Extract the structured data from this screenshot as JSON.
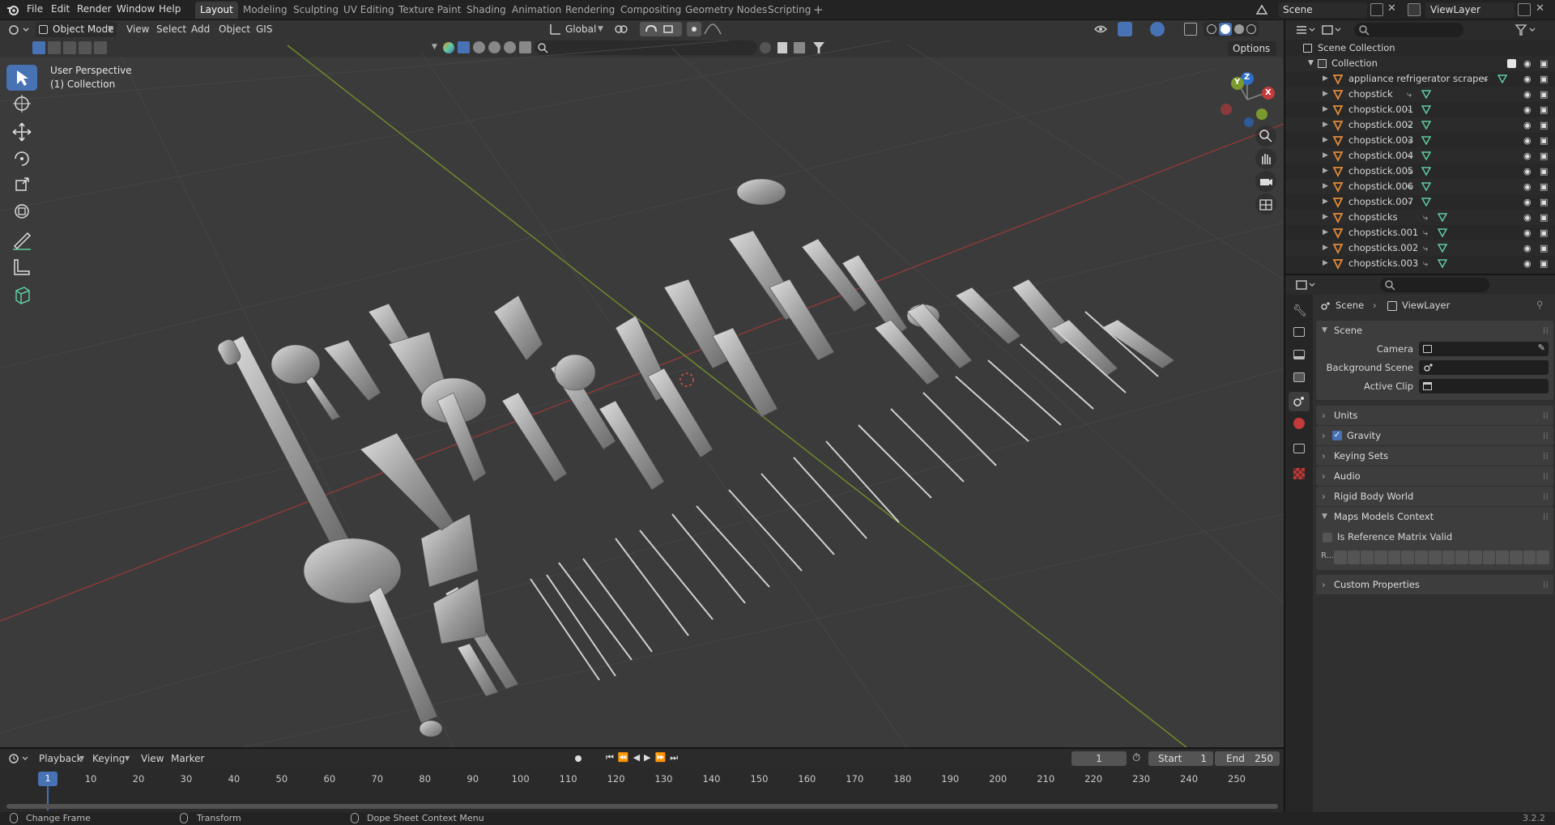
{
  "app": {
    "version": "3.2.2"
  },
  "menubar": {
    "items": [
      "File",
      "Edit",
      "Render",
      "Window",
      "Help"
    ]
  },
  "workspaces": {
    "tabs": [
      "Layout",
      "Modeling",
      "Sculpting",
      "UV Editing",
      "Texture Paint",
      "Shading",
      "Animation",
      "Rendering",
      "Compositing",
      "Geometry Nodes",
      "Scripting"
    ],
    "active": "Layout",
    "add": "+"
  },
  "topright": {
    "scene": "Scene",
    "view_layer": "ViewLayer"
  },
  "viewport_header": {
    "mode": "Object Mode",
    "menus": [
      "View",
      "Select",
      "Add",
      "Object",
      "GIS"
    ],
    "orientation": "Global",
    "options": "Options"
  },
  "viewport": {
    "perspective": "User Perspective",
    "collection": "(1) Collection",
    "gizmo": {
      "x": "X",
      "y": "Y",
      "z": "Z"
    }
  },
  "tools": [
    {
      "name": "select-box-tool",
      "active": true
    },
    {
      "name": "cursor-tool",
      "active": false
    },
    {
      "name": "move-tool",
      "active": false
    },
    {
      "name": "rotate-tool",
      "active": false
    },
    {
      "name": "scale-tool",
      "active": false
    },
    {
      "name": "transform-tool",
      "active": false
    },
    {
      "name": "annotate-tool",
      "active": false
    },
    {
      "name": "measure-tool",
      "active": false
    },
    {
      "name": "add-cube-tool",
      "active": false
    }
  ],
  "outliner": {
    "root": "Scene Collection",
    "collection": "Collection",
    "items": [
      "appliance refrigerator scraper",
      "chopstick",
      "chopstick.001",
      "chopstick.002",
      "chopstick.003",
      "chopstick.004",
      "chopstick.005",
      "chopstick.006",
      "chopstick.007",
      "chopsticks",
      "chopsticks.001",
      "chopsticks.002",
      "chopsticks.003"
    ]
  },
  "properties": {
    "breadcrumb": [
      "Scene",
      "ViewLayer"
    ],
    "panel_title": "Scene",
    "fields": [
      {
        "label": "Camera",
        "value": ""
      },
      {
        "label": "Background Scene",
        "value": ""
      },
      {
        "label": "Active Clip",
        "value": ""
      }
    ],
    "sections": [
      "Units",
      "Gravity",
      "Keying Sets",
      "Audio",
      "Rigid Body World",
      "Maps Models Context"
    ],
    "gravity_checked": true,
    "maps_models": {
      "checkbox_label": "Is Reference Matrix Valid",
      "checked": false,
      "matrix_label": "R..."
    },
    "custom": "Custom Properties"
  },
  "timeline": {
    "menus": [
      "Playback",
      "Keying",
      "View",
      "Marker"
    ],
    "current_frame": "1",
    "start_label": "Start",
    "start": "1",
    "end_label": "End",
    "end": "250",
    "ticks": [
      "1",
      "10",
      "20",
      "30",
      "40",
      "50",
      "60",
      "70",
      "80",
      "90",
      "100",
      "110",
      "120",
      "130",
      "140",
      "150",
      "160",
      "170",
      "180",
      "190",
      "200",
      "210",
      "220",
      "230",
      "240",
      "250"
    ]
  },
  "statusbar": {
    "items": [
      "Change Frame",
      "Transform",
      "Dope Sheet Context Menu"
    ]
  },
  "colors": {
    "accent": "#4772b3",
    "x_axis": "#c23a3a",
    "y_axis": "#7a9a2e",
    "z_axis": "#2e6fc9",
    "orange": "#e08b3a",
    "mesh": "#5fcba0"
  }
}
